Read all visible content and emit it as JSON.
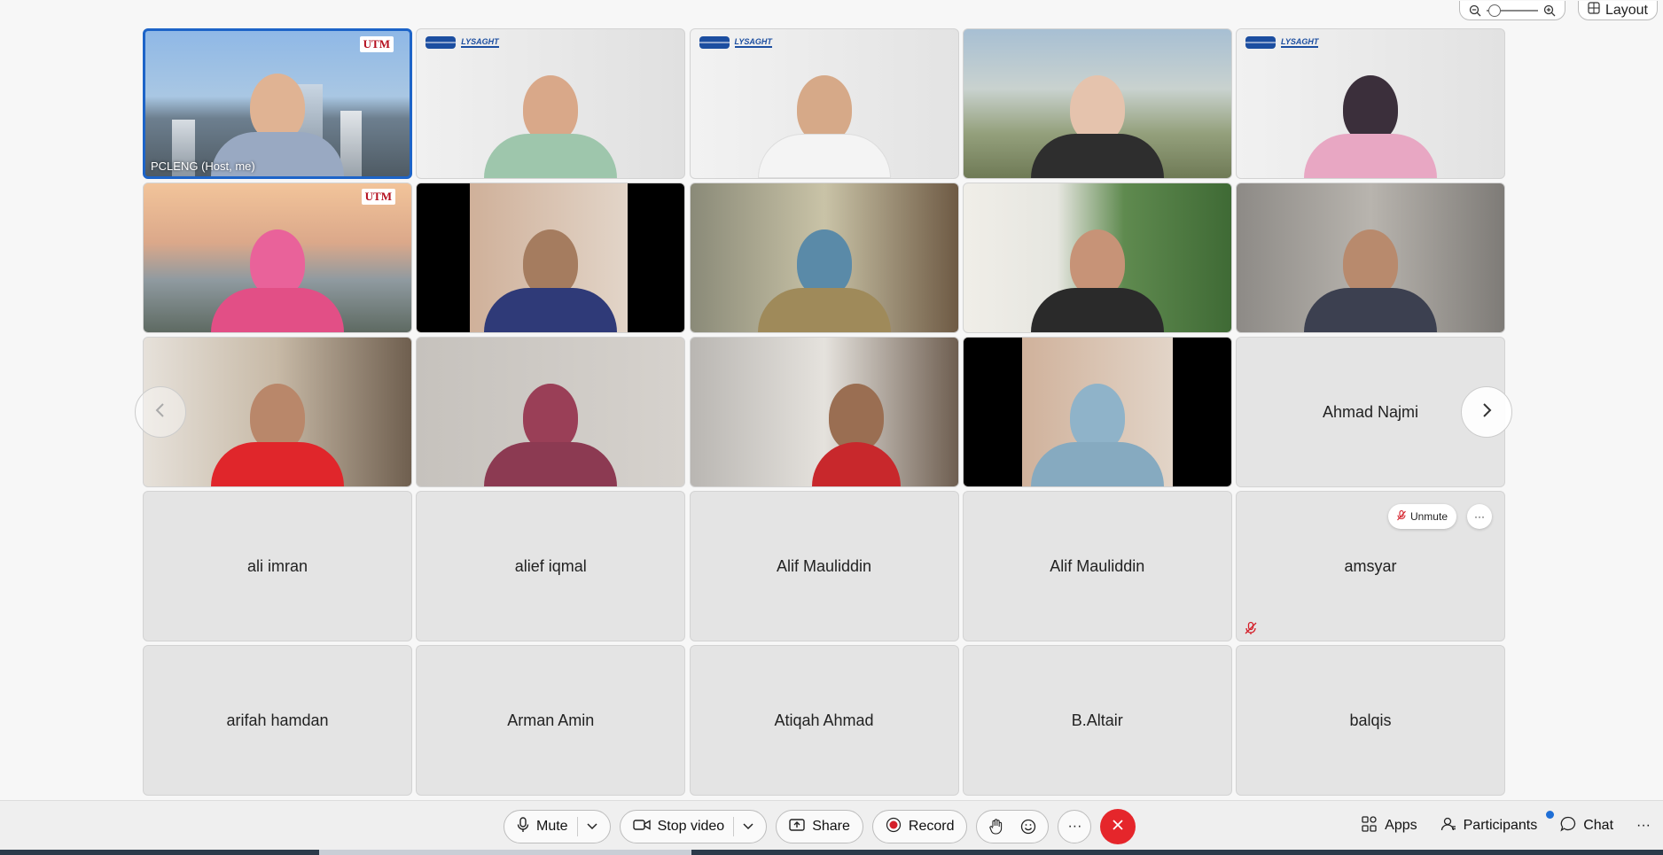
{
  "top_controls": {
    "zoom_out_icon": "zoom-out-icon",
    "zoom_in_icon": "zoom-in-icon",
    "zoom_level": 0.05,
    "layout_label": "Layout"
  },
  "participants": [
    {
      "name": "PCLENG (Host, me)",
      "video": true,
      "active": true,
      "logo": "UTM"
    },
    {
      "name": "",
      "video": true,
      "logo": "LYSAGHT"
    },
    {
      "name": "",
      "video": true,
      "logo": "LYSAGHT"
    },
    {
      "name": "",
      "video": true
    },
    {
      "name": "",
      "video": true,
      "logo": "LYSAGHT"
    },
    {
      "name": "",
      "video": true,
      "logo": "UTM"
    },
    {
      "name": "",
      "video": true
    },
    {
      "name": "",
      "video": true
    },
    {
      "name": "",
      "video": true
    },
    {
      "name": "",
      "video": true
    },
    {
      "name": "",
      "video": true
    },
    {
      "name": "",
      "video": true
    },
    {
      "name": "",
      "video": true
    },
    {
      "name": "",
      "video": true
    },
    {
      "name": "Ahmad Najmi",
      "video": false
    },
    {
      "name": "ali imran",
      "video": false
    },
    {
      "name": "alief iqmal",
      "video": false
    },
    {
      "name": "Alif Mauliddin",
      "video": false
    },
    {
      "name": "Alif Mauliddin",
      "video": false
    },
    {
      "name": "amsyar",
      "video": false,
      "muted": true
    },
    {
      "name": "arifah hamdan",
      "video": false
    },
    {
      "name": "Arman Amin",
      "video": false
    },
    {
      "name": "Atiqah Ahmad",
      "video": false
    },
    {
      "name": "B.Altair",
      "video": false
    },
    {
      "name": "balqis",
      "video": false
    }
  ],
  "tile_actions": {
    "unmute_label": "Unmute",
    "more_label": "···"
  },
  "toolbar": {
    "mute_label": "Mute",
    "stop_video_label": "Stop video",
    "share_label": "Share",
    "record_label": "Record",
    "more_label": "···",
    "apps_label": "Apps",
    "participants_label": "Participants",
    "chat_label": "Chat",
    "overflow_label": "···"
  },
  "colors": {
    "accent": "#1d64c8",
    "end_call": "#e5262b",
    "record_dot": "#d4202a",
    "notification": "#1f6fd6"
  }
}
